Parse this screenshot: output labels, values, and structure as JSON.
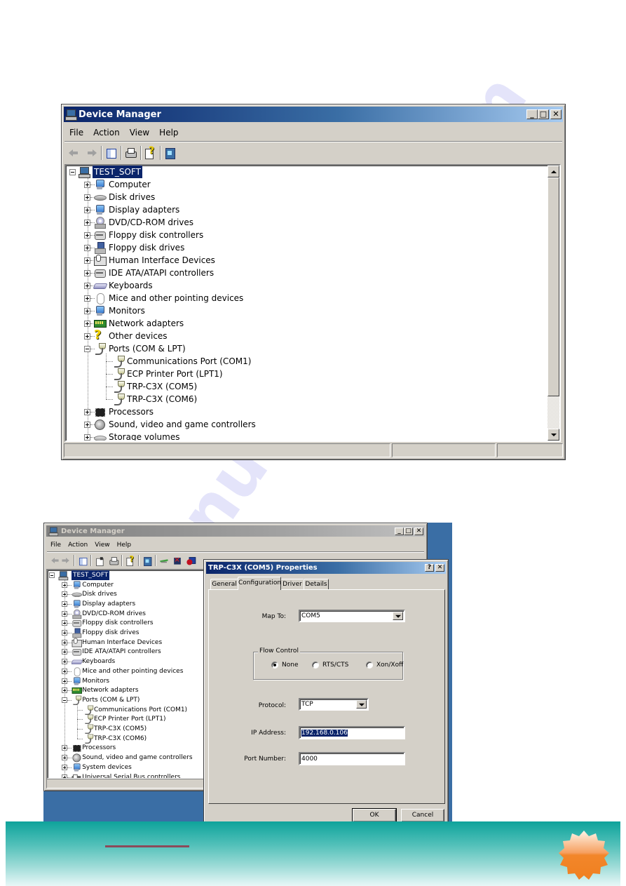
{
  "watermark": "manualshive.com",
  "window1": {
    "title": "Device Manager",
    "caption_buttons": {
      "minimize": "_",
      "maximize": "□",
      "close": "✕"
    },
    "menu": [
      "File",
      "Action",
      "View",
      "Help"
    ],
    "toolbar": [
      {
        "name": "back-icon"
      },
      {
        "name": "forward-icon"
      },
      {
        "sep": true
      },
      {
        "name": "show-hide-console-tree-icon"
      },
      {
        "sep": true
      },
      {
        "name": "print-icon"
      },
      {
        "sep": true
      },
      {
        "name": "help-icon"
      },
      {
        "sep": true
      },
      {
        "name": "scan-hardware-icon"
      }
    ],
    "tree": {
      "root": "TEST_SOFT",
      "items": [
        {
          "label": "Computer",
          "icon": "computer-icon"
        },
        {
          "label": "Disk drives",
          "icon": "disk-drive-icon"
        },
        {
          "label": "Display adapters",
          "icon": "display-adapter-icon"
        },
        {
          "label": "DVD/CD-ROM drives",
          "icon": "cd-rom-icon"
        },
        {
          "label": "Floppy disk controllers",
          "icon": "floppy-controller-icon"
        },
        {
          "label": "Floppy disk drives",
          "icon": "floppy-drive-icon"
        },
        {
          "label": "Human Interface Devices",
          "icon": "hid-icon"
        },
        {
          "label": "IDE ATA/ATAPI controllers",
          "icon": "ide-controller-icon"
        },
        {
          "label": "Keyboards",
          "icon": "keyboard-icon"
        },
        {
          "label": "Mice and other pointing devices",
          "icon": "mouse-icon"
        },
        {
          "label": "Monitors",
          "icon": "monitor-icon"
        },
        {
          "label": "Network adapters",
          "icon": "network-adapter-icon"
        },
        {
          "label": "Other devices",
          "icon": "unknown-device-icon"
        },
        {
          "label": "Ports (COM & LPT)",
          "icon": "port-icon",
          "expanded": true,
          "children": [
            "Communications Port (COM1)",
            "ECP Printer Port (LPT1)",
            "TRP-C3X (COM5)",
            "TRP-C3X (COM6)"
          ]
        },
        {
          "label": "Processors",
          "icon": "processor-icon"
        },
        {
          "label": "Sound, video and game controllers",
          "icon": "sound-icon"
        },
        {
          "label": "Storage volumes",
          "icon": "storage-volume-icon"
        }
      ]
    },
    "scroll_position": 0.0
  },
  "window2": {
    "title": "Device Manager",
    "caption_buttons": {
      "minimize": "_",
      "maximize": "□",
      "close": "✕"
    },
    "menu": [
      "File",
      "Action",
      "View",
      "Help"
    ],
    "tree": {
      "root": "TEST_SOFT",
      "items": [
        {
          "label": "Computer",
          "icon": "computer-icon"
        },
        {
          "label": "Disk drives",
          "icon": "disk-drive-icon"
        },
        {
          "label": "Display adapters",
          "icon": "display-adapter-icon"
        },
        {
          "label": "DVD/CD-ROM drives",
          "icon": "cd-rom-icon"
        },
        {
          "label": "Floppy disk controllers",
          "icon": "floppy-controller-icon"
        },
        {
          "label": "Floppy disk drives",
          "icon": "floppy-drive-icon"
        },
        {
          "label": "Human Interface Devices",
          "icon": "hid-icon"
        },
        {
          "label": "IDE ATA/ATAPI controllers",
          "icon": "ide-controller-icon"
        },
        {
          "label": "Keyboards",
          "icon": "keyboard-icon"
        },
        {
          "label": "Mice and other pointing devices",
          "icon": "mouse-icon"
        },
        {
          "label": "Monitors",
          "icon": "monitor-icon"
        },
        {
          "label": "Network adapters",
          "icon": "network-adapter-icon"
        },
        {
          "label": "Ports (COM & LPT)",
          "icon": "port-icon",
          "expanded": true,
          "children": [
            "Communications Port (COM1)",
            "ECP Printer Port (LPT1)",
            "TRP-C3X (COM5)",
            "TRP-C3X (COM6)"
          ]
        },
        {
          "label": "Processors",
          "icon": "processor-icon"
        },
        {
          "label": "Sound, video and game controllers",
          "icon": "sound-icon"
        },
        {
          "label": "System devices",
          "icon": "system-device-icon"
        },
        {
          "label": "Universal Serial Bus controllers",
          "icon": "usb-icon"
        }
      ]
    }
  },
  "dialog": {
    "title": "TRP-C3X (COM5) Properties",
    "caption_buttons": {
      "help": "?",
      "close": "✕"
    },
    "tabs": [
      "General",
      "Configuration",
      "Driver",
      "Details"
    ],
    "active_tab": "Configuration",
    "map_to": {
      "label": "Map To:",
      "value": "COM5"
    },
    "flow_control": {
      "title": "Flow Control",
      "options": [
        "None",
        "RTS/CTS",
        "Xon/Xoff"
      ],
      "selected": "None"
    },
    "protocol": {
      "label": "Protocol:",
      "value": "TCP"
    },
    "ip_address": {
      "label": "IP Address:",
      "value": "192.168.0.106"
    },
    "port_number": {
      "label": "Port Number:",
      "value": "4000"
    },
    "ok_label": "OK",
    "cancel_label": "Cancel"
  },
  "colors": {
    "title_active_start": "#0a246a",
    "title_active_end": "#a6caf0",
    "window_face": "#d4d0c8",
    "selection": "#0a246a",
    "desktop": "#3a6ea5",
    "footer_teal": "#0ea39b",
    "badge_orange": "#f2862a"
  }
}
